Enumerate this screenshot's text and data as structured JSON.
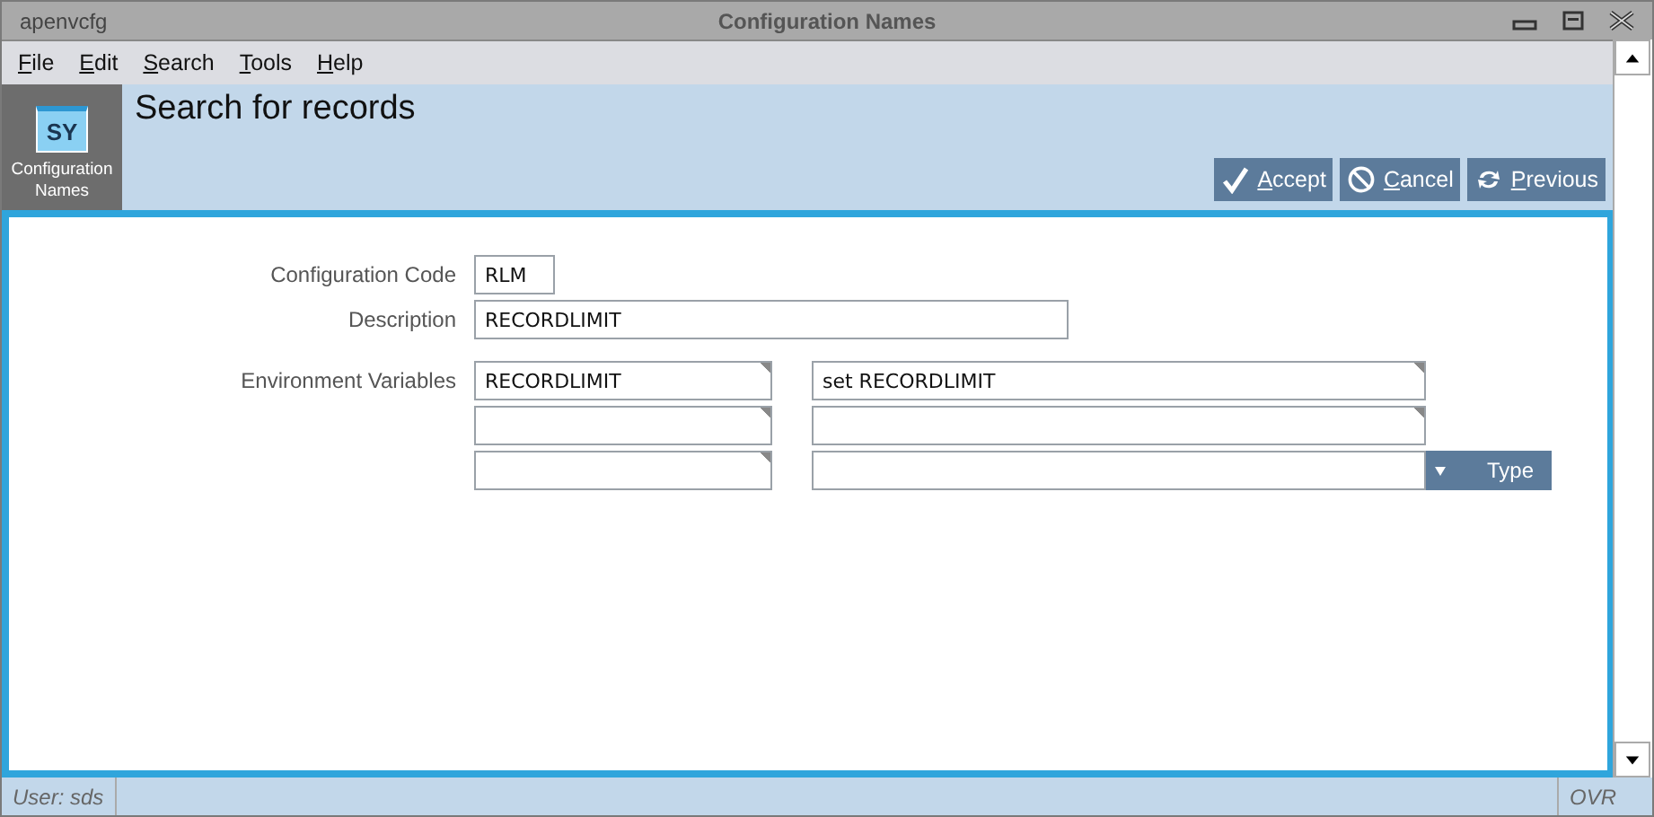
{
  "window": {
    "app": "apenvcfg",
    "title": "Configuration Names"
  },
  "menu": [
    {
      "label": "File"
    },
    {
      "label": "Edit"
    },
    {
      "label": "Search"
    },
    {
      "label": "Tools"
    },
    {
      "label": "Help"
    }
  ],
  "module": {
    "code": "SY",
    "name": "Configuration Names"
  },
  "heading": "Search for records",
  "actions": [
    {
      "label": "Accept",
      "kind": "accept"
    },
    {
      "label": "Cancel",
      "kind": "cancel"
    },
    {
      "label": "Previous",
      "kind": "previous"
    }
  ],
  "fields": [
    {
      "label": "Configuration Code",
      "value": "RLM",
      "kind": "short"
    },
    {
      "label": "Description",
      "value": "RECORDLIMIT",
      "kind": "long"
    }
  ],
  "environment_variables": {
    "label": "Environment Variables",
    "type_button": "Type",
    "rows": [
      {
        "name": "RECORDLIMIT",
        "value": "set RECORDLIMIT"
      },
      {},
      {}
    ]
  },
  "status_bar": {
    "user": "User: sds",
    "mode": "OVR"
  }
}
